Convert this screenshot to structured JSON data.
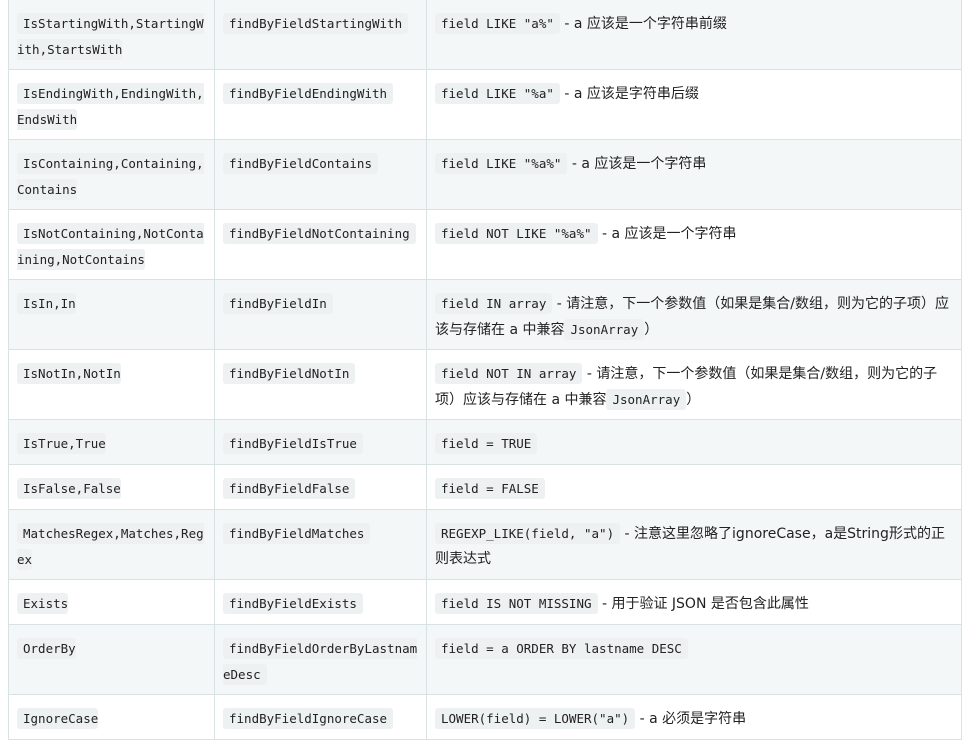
{
  "rows": [
    {
      "keyword": "IsStartingWith,StartingWith,StartsWith",
      "sample": "findByFieldStartingWith",
      "code": "field LIKE \"a%\"",
      "desc": " - a 应该是一个字符串前缀",
      "code2": "",
      "desc2": ""
    },
    {
      "keyword": "IsEndingWith,EndingWith,EndsWith",
      "sample": "findByFieldEndingWith",
      "code": "field LIKE \"%a\"",
      "desc": " - a 应该是字符串后缀",
      "code2": "",
      "desc2": ""
    },
    {
      "keyword": "IsContaining,Containing,Contains",
      "sample": "findByFieldContains",
      "code": "field LIKE \"%a%\"",
      "desc": " - a 应该是一个字符串",
      "code2": "",
      "desc2": ""
    },
    {
      "keyword": "IsNotContaining,NotContaining,NotContains",
      "sample": "findByFieldNotContaining",
      "code": "field NOT LIKE \"%a%\"",
      "desc": " - a 应该是一个字符串",
      "code2": "",
      "desc2": ""
    },
    {
      "keyword": "IsIn,In",
      "sample": "findByFieldIn",
      "code": "field IN array",
      "desc": " - 请注意，下一个参数值（如果是集合/数组，则为它的子项）应该与存储在 a 中兼容",
      "code2": "JsonArray",
      "desc2": "）"
    },
    {
      "keyword": "IsNotIn,NotIn",
      "sample": "findByFieldNotIn",
      "code": "field NOT IN array",
      "desc": " - 请注意，下一个参数值（如果是集合/数组，则为它的子项）应该与存储在 a 中兼容",
      "code2": "JsonArray",
      "desc2": "）"
    },
    {
      "keyword": "IsTrue,True",
      "sample": "findByFieldIsTrue",
      "code": "field = TRUE",
      "desc": "",
      "code2": "",
      "desc2": ""
    },
    {
      "keyword": "IsFalse,False",
      "sample": "findByFieldFalse",
      "code": "field = FALSE",
      "desc": "",
      "code2": "",
      "desc2": ""
    },
    {
      "keyword": "MatchesRegex,Matches,Regex",
      "sample": "findByFieldMatches",
      "code": "REGEXP_LIKE(field, \"a\")",
      "desc": " - 注意这里忽略了ignoreCase，a是String形式的正则表达式",
      "code2": "",
      "desc2": ""
    },
    {
      "keyword": "Exists",
      "sample": "findByFieldExists",
      "code": "field IS NOT MISSING",
      "desc": " - 用于验证 JSON 是否包含此属性",
      "code2": "",
      "desc2": ""
    },
    {
      "keyword": "OrderBy",
      "sample": "findByFieldOrderByLastnameDesc",
      "code": "field = a ORDER BY lastname DESC",
      "desc": "",
      "code2": "",
      "desc2": ""
    },
    {
      "keyword": "IgnoreCase",
      "sample": "findByFieldIgnoreCase",
      "code": "LOWER(field) = LOWER(\"a\")",
      "desc": " - a 必须是字符串",
      "code2": "",
      "desc2": ""
    }
  ]
}
